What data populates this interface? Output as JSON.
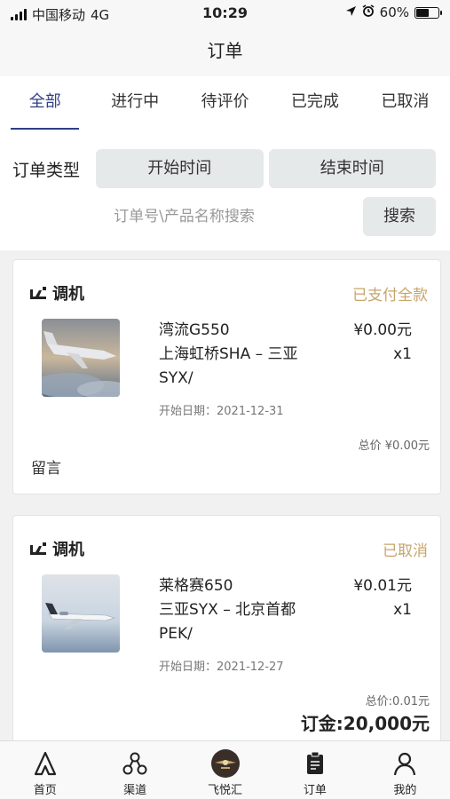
{
  "status_bar": {
    "carrier": "中国移动",
    "network": "4G",
    "time": "10:29",
    "battery": "60%",
    "battery_level": 0.6
  },
  "nav": {
    "title": "订单"
  },
  "tabs": [
    {
      "label": "全部",
      "active": true
    },
    {
      "label": "进行中"
    },
    {
      "label": "待评价"
    },
    {
      "label": "已完成"
    },
    {
      "label": "已取消"
    }
  ],
  "filters": {
    "type_label": "订单类型",
    "start_time": "开始时间",
    "end_time": "结束时间",
    "search_placeholder": "订单号\\产品名称搜索",
    "search_button": "搜索"
  },
  "orders": [
    {
      "category": "调机",
      "status": "已支付全款",
      "product": "湾流G550",
      "route": "上海虹桥SHA – 三亚SYX/",
      "route_line1": "上海虹桥SHA – 三亚",
      "route_line2": "SYX/",
      "start_date": "开始日期：2021-12-31",
      "price": "¥0.00元",
      "qty": "x1",
      "total": "总价 ¥0.00元",
      "message": "留言"
    },
    {
      "category": "调机",
      "status": "已取消",
      "product": "莱格赛650",
      "route": "三亚SYX – 北京首都PEK/",
      "route_line1": "三亚SYX – 北京首都",
      "route_line2": "PEK/",
      "start_date": "开始日期：2021-12-27",
      "price": "¥0.01元",
      "qty": "x1",
      "total": "总价:0.01元",
      "deposit": "订金:20,000元"
    }
  ],
  "tab_bar": [
    {
      "label": "首页",
      "icon": "home-icon"
    },
    {
      "label": "渠道",
      "icon": "channel-icon"
    },
    {
      "label": "飞悦汇",
      "icon": "logo-icon"
    },
    {
      "label": "订单",
      "icon": "order-icon"
    },
    {
      "label": "我的",
      "icon": "profile-icon"
    }
  ],
  "colors": {
    "accent": "#2f3f86",
    "gold": "#c7a56a"
  }
}
